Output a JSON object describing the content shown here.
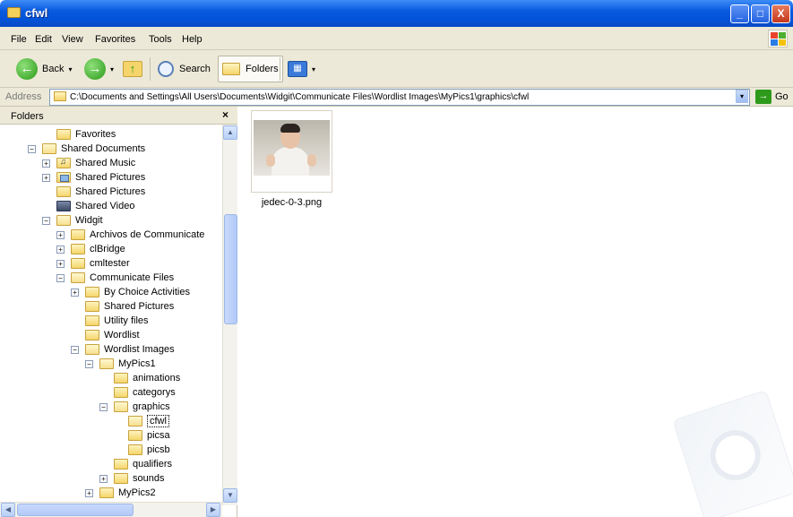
{
  "window": {
    "title": "cfwl",
    "minimize_glyph": "_",
    "maximize_glyph": "□",
    "close_glyph": "X"
  },
  "menu": [
    "File",
    "Edit",
    "View",
    "Favorites",
    "Tools",
    "Help"
  ],
  "toolbar": {
    "back_label": "Back",
    "dropdown_glyph": "▾",
    "search_label": "Search",
    "folders_label": "Folders"
  },
  "address": {
    "label": "Address",
    "path": "C:\\Documents and Settings\\All Users\\Documents\\Widgit\\Communicate Files\\Wordlist Images\\MyPics1\\graphics\\cfwl",
    "go_label": "Go"
  },
  "folders_pane": {
    "title": "Folders",
    "close_glyph": "×"
  },
  "tree": [
    {
      "label": "Favorites",
      "expander": "",
      "icon": "folder-icon"
    },
    {
      "label": "Shared Documents",
      "expander": "−",
      "icon": "folder-open-icon"
    },
    {
      "label": "Shared Music",
      "expander": "+",
      "icon": "music-folder-icon"
    },
    {
      "label": "Shared Pictures",
      "expander": "+",
      "icon": "pictures-folder-icon"
    },
    {
      "label": "Shared Pictures",
      "expander": "",
      "icon": "folder-icon"
    },
    {
      "label": "Shared Video",
      "expander": "",
      "icon": "video-folder-icon"
    },
    {
      "label": "Widgit",
      "expander": "−",
      "icon": "folder-open-icon"
    },
    {
      "label": "Archivos de Communicate",
      "expander": "+",
      "icon": "folder-icon"
    },
    {
      "label": "clBridge",
      "expander": "+",
      "icon": "folder-icon"
    },
    {
      "label": "cmltester",
      "expander": "+",
      "icon": "folder-icon"
    },
    {
      "label": "Communicate Files",
      "expander": "−",
      "icon": "folder-open-icon"
    },
    {
      "label": "By Choice Activities",
      "expander": "+",
      "icon": "folder-icon"
    },
    {
      "label": "Shared Pictures",
      "expander": "",
      "icon": "folder-icon"
    },
    {
      "label": "Utility files",
      "expander": "",
      "icon": "folder-icon"
    },
    {
      "label": "Wordlist",
      "expander": "",
      "icon": "folder-icon"
    },
    {
      "label": "Wordlist Images",
      "expander": "−",
      "icon": "folder-open-icon"
    },
    {
      "label": "MyPics1",
      "expander": "−",
      "icon": "folder-open-icon"
    },
    {
      "label": "animations",
      "expander": "",
      "icon": "folder-icon"
    },
    {
      "label": "categorys",
      "expander": "",
      "icon": "folder-icon"
    },
    {
      "label": "graphics",
      "expander": "−",
      "icon": "folder-open-icon"
    },
    {
      "label": "cfwl",
      "expander": "",
      "icon": "folder-open-icon",
      "selected": true
    },
    {
      "label": "picsa",
      "expander": "",
      "icon": "folder-icon"
    },
    {
      "label": "picsb",
      "expander": "",
      "icon": "folder-icon"
    },
    {
      "label": "qualifiers",
      "expander": "",
      "icon": "folder-icon"
    },
    {
      "label": "sounds",
      "expander": "+",
      "icon": "folder-icon"
    },
    {
      "label": "MyPics2",
      "expander": "+",
      "icon": "folder-icon"
    }
  ],
  "scroll": {
    "up": "▲",
    "down": "▼",
    "left": "◀",
    "right": "▶"
  },
  "files": [
    {
      "name": "jedec-0-3.png",
      "icon": "baby-photo-thumbnail"
    }
  ]
}
